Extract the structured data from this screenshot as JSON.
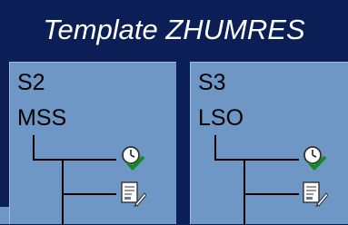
{
  "title": "Template ZHUMRES",
  "colors": {
    "background": "#0b1f56",
    "panel": "#6e97c6",
    "title_text": "#ffffff",
    "label_text": "#000000"
  },
  "panels": [
    {
      "code": "S2",
      "name": "MSS",
      "icons": [
        "clock-check-icon",
        "document-edit-icon"
      ]
    },
    {
      "code": "S3",
      "name": "LSO",
      "icons": [
        "clock-check-icon",
        "document-edit-icon"
      ]
    }
  ]
}
